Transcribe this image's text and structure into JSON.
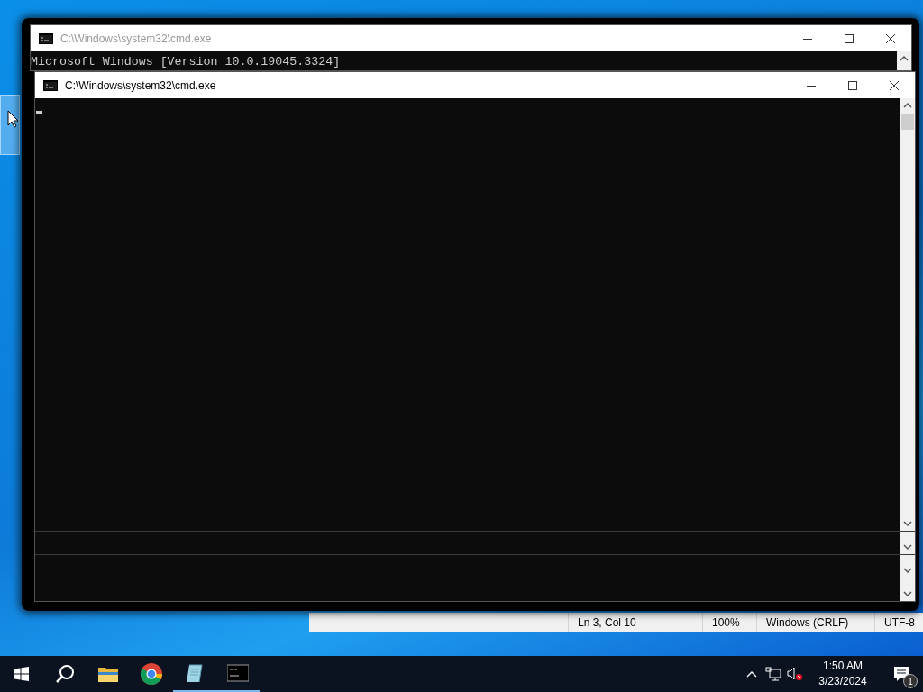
{
  "windows": [
    {
      "title": "C:\\Windows\\system32\\cmd.exe",
      "lines": [
        "Microsoft Windows [Version 10.0.19045.3324]"
      ],
      "active": false
    },
    {
      "title": "C:\\Windows\\system32\\cmd.exe",
      "cursor": true,
      "active": true
    }
  ],
  "notepad_status": [
    "Ln 3, Col 10",
    "100%",
    "Windows (CRLF)",
    "UTF-8"
  ],
  "taskbar": {
    "apps": [
      {
        "kind": "explorer",
        "running": false
      },
      {
        "kind": "chrome",
        "running": false
      },
      {
        "kind": "notepad",
        "running": true
      },
      {
        "kind": "console",
        "running": true
      }
    ],
    "time": "1:50 AM",
    "date": "3/23/2024",
    "notification_count": "1"
  }
}
